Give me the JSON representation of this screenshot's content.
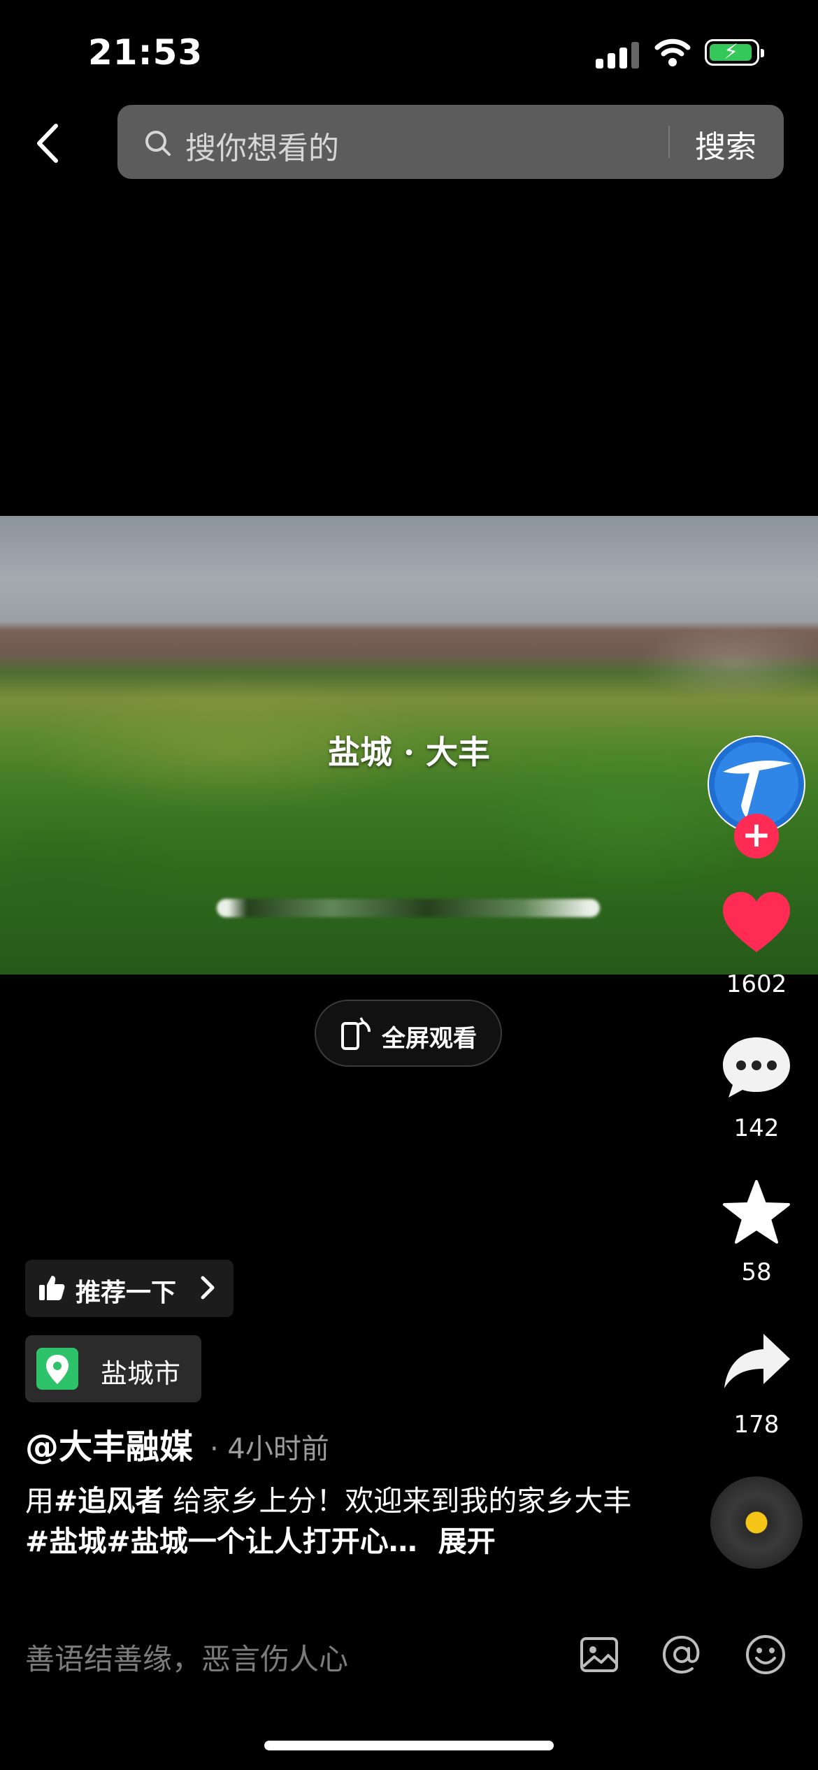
{
  "status_bar": {
    "time": "21:53"
  },
  "header": {
    "search_placeholder": "搜你想看的",
    "search_button": "搜索"
  },
  "video": {
    "title_overlay": "盐城 · 大丰",
    "fullscreen_label": "全屏观看"
  },
  "actions": {
    "likes": "1602",
    "comments": "142",
    "favorites": "58",
    "shares": "178"
  },
  "recommend": {
    "label": "推荐一下"
  },
  "location": {
    "label": "盐城市"
  },
  "post": {
    "author": "@大丰融媒",
    "time_ago": "· 4小时前",
    "desc_prefix": "用",
    "tag1": "#追风者",
    "desc_mid": " 给家乡上分！欢迎来到我的家乡大丰",
    "tag2": "#盐城",
    "tag3": "#盐城一个让人打开心…",
    "expand": "展开"
  },
  "comment_bar": {
    "placeholder": "善语结善缘，恶言伤人心"
  },
  "colors": {
    "like": "#fe2c55",
    "location_badge": "#2ec36a",
    "battery": "#34c759",
    "disc_dot": "#f5c518"
  }
}
